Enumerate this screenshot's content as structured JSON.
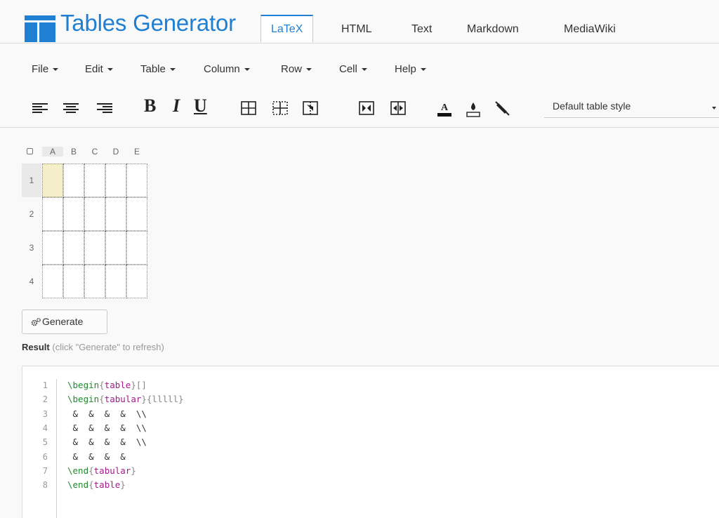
{
  "header": {
    "brand": "Tables Generator",
    "tabs": [
      {
        "label": "LaTeX",
        "active": true
      },
      {
        "label": "HTML"
      },
      {
        "label": "Text"
      },
      {
        "label": "Markdown"
      },
      {
        "label": "MediaWiki"
      }
    ]
  },
  "menu": [
    {
      "label": "File"
    },
    {
      "label": "Edit"
    },
    {
      "label": "Table"
    },
    {
      "label": "Column"
    },
    {
      "label": "Row"
    },
    {
      "label": "Cell"
    },
    {
      "label": "Help"
    }
  ],
  "toolbar": {
    "bold_glyph": "B",
    "italic_glyph": "I",
    "underline_glyph": "U",
    "table_style_value": "Default table style"
  },
  "grid": {
    "columns": [
      "A",
      "B",
      "C",
      "D",
      "E"
    ],
    "rows": [
      "1",
      "2",
      "3",
      "4"
    ],
    "selected_cell": "A1"
  },
  "generate": {
    "button_label": "Generate",
    "result_label": "Result",
    "result_hint": "(click \"Generate\" to refresh)"
  },
  "code": {
    "line_numbers": [
      "1",
      "2",
      "3",
      "4",
      "5",
      "6",
      "7",
      "8"
    ],
    "lines": [
      "\\begin{table}[]",
      "\\begin{tabular}{lllll}",
      " &  &  &  &  \\\\",
      " &  &  &  &  \\\\",
      " &  &  &  &  \\\\",
      " &  &  &  &",
      "\\end{tabular}",
      "\\end{table}"
    ]
  },
  "colors": {
    "brand_blue": "#1f7fd2",
    "selected_cell": "#f4efc8",
    "latex_keyword": "#1e8a2c",
    "latex_argument": "#a31b8c"
  }
}
